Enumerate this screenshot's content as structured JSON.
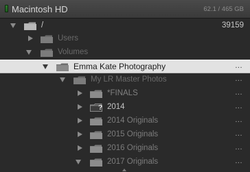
{
  "volume": {
    "name": "Macintosh HD",
    "size": "62.1 / 465 GB",
    "status_color": "#2f7d2f"
  },
  "folders": {
    "root": {
      "label": "/",
      "count": "39159"
    },
    "users": {
      "label": "Users"
    },
    "volumes": {
      "label": "Volumes"
    },
    "emma": {
      "label": "Emma Kate Photography",
      "menu": "..."
    },
    "master": {
      "label": "My LR Master Photos",
      "menu": "..."
    },
    "finals": {
      "label": "*FINALS",
      "menu": "..."
    },
    "y2014": {
      "label": "2014",
      "menu": "...",
      "missing_mark": "?"
    },
    "o2014": {
      "label": "2014 Originals",
      "menu": "..."
    },
    "o2015": {
      "label": "2015 Originals",
      "menu": "..."
    },
    "o2016": {
      "label": "2016 Originals",
      "menu": "..."
    },
    "o2017": {
      "label": "2017 Originals",
      "menu": "..."
    }
  },
  "colors": {
    "panel_bg": "#2a2a2a",
    "selected_bg": "#e2e2e2",
    "folder_fill": "#9a9a9a"
  }
}
